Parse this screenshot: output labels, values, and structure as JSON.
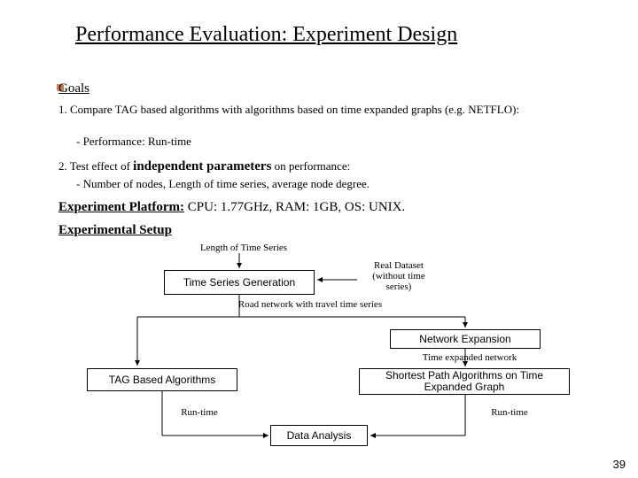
{
  "title": "Performance Evaluation: Experiment Design",
  "goals_heading": "Goals",
  "g1": "1. Compare TAG based algorithms with algorithms based on time expanded graphs (e.g. NETFLO):",
  "g1_sub": "- Performance: Run-time",
  "g2_pre": "2. Test effect of ",
  "g2_bold": "independent parameters",
  "g2_post": " on performance:",
  "g2_sub": "- Number of nodes, Length of time series, average node degree.",
  "platform_label": "Experiment Platform:",
  "platform_val": " CPU: 1.77GHz, RAM: 1GB, OS: UNIX.",
  "setup_heading": "Experimental Setup",
  "diagram": {
    "len_ts": "Length of Time Series",
    "tsg": "Time Series Generation",
    "real_dataset": "Real Dataset (without time series)",
    "road_net": "Road network with travel time series",
    "net_exp": "Network Expansion",
    "te_net": "Time expanded  network",
    "tag": "TAG Based Algorithms",
    "spa": "Shortest Path Algorithms on Time Expanded Graph",
    "runtime_l": "Run-time",
    "runtime_r": "Run-time",
    "data_analysis": "Data Analysis"
  },
  "page_number": "39"
}
